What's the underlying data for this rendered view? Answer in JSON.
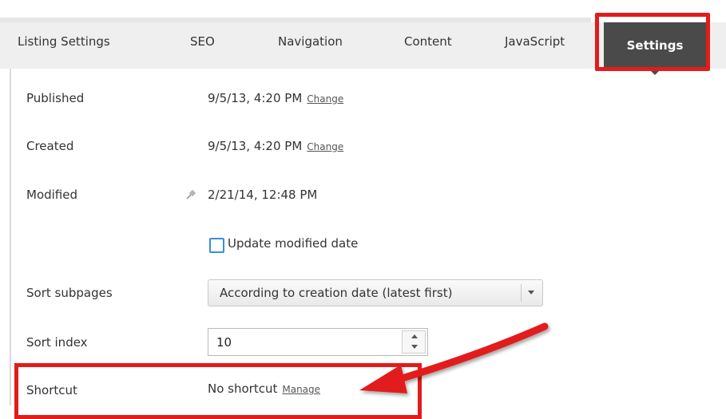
{
  "tabs": [
    {
      "label": "Listing Settings"
    },
    {
      "label": "SEO"
    },
    {
      "label": "Navigation"
    },
    {
      "label": "Content"
    },
    {
      "label": "JavaScript"
    },
    {
      "label": "Settings",
      "active": true
    }
  ],
  "fields": {
    "published": {
      "label": "Published",
      "value": "9/5/13, 4:20 PM",
      "action": "Change"
    },
    "created": {
      "label": "Created",
      "value": "9/5/13, 4:20 PM",
      "action": "Change"
    },
    "modified": {
      "label": "Modified",
      "value": "2/21/14, 12:48 PM",
      "icon": "pin-icon"
    },
    "update_modified": {
      "label": "Update modified date",
      "checked": false
    },
    "sort_subpages": {
      "label": "Sort subpages",
      "selected": "According to creation date (latest first)"
    },
    "sort_index": {
      "label": "Sort index",
      "value": "10"
    },
    "shortcut": {
      "label": "Shortcut",
      "value": "No shortcut",
      "action": "Manage"
    }
  },
  "colors": {
    "highlight": "#e21b1b",
    "active_tab_bg": "#4a4a4a",
    "tabbar_bg": "#efefef",
    "checkbox_border": "#3a8ed8"
  }
}
